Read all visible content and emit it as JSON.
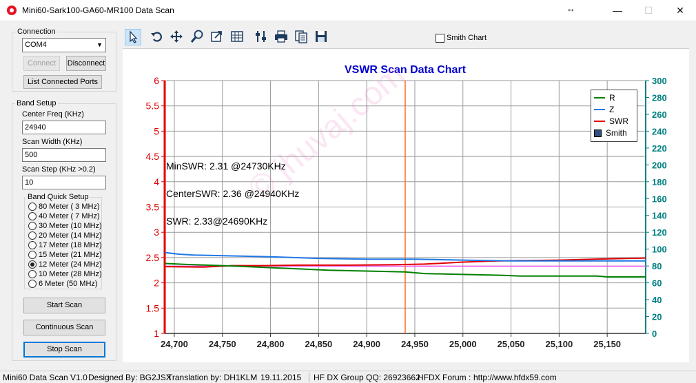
{
  "window": {
    "title": "Mini60-Sark100-GA60-MR100 Data Scan",
    "resize_glyph": "↔",
    "controls": {
      "minimize": "—",
      "maximize": "☐",
      "close": "✕"
    }
  },
  "connection": {
    "label": "Connection",
    "port_value": "COM4",
    "connect_label": "Connect",
    "disconnect_label": "Disconnect",
    "list_ports_label": "List Connected Ports"
  },
  "band_setup": {
    "label": "Band Setup",
    "center_freq_label": "Center Freq  (KHz)",
    "center_freq_value": "24940",
    "scan_width_label": "Scan Width   (KHz)",
    "scan_width_value": "500",
    "scan_step_label": "Scan Step     (KHz >0.2)",
    "scan_step_value": "10",
    "quick_setup_label": "Band Quick Setup",
    "bands": [
      {
        "label": "80 Meter (  3 MHz)",
        "checked": false
      },
      {
        "label": "40 Meter (  7 MHz)",
        "checked": false
      },
      {
        "label": "30 Meter (10 MHz)",
        "checked": false
      },
      {
        "label": "20 Meter (14 MHz)",
        "checked": false
      },
      {
        "label": "17 Meter (18 MHz)",
        "checked": false
      },
      {
        "label": "15 Meter (21 MHz)",
        "checked": false
      },
      {
        "label": "12 Meter (24 MHz)",
        "checked": true
      },
      {
        "label": "10 Meter (28 MHz)",
        "checked": false
      },
      {
        "label": "6 Meter  (50 MHz)",
        "checked": false
      }
    ],
    "start_scan_label": "Start Scan",
    "continuous_scan_label": "Continuous Scan",
    "stop_scan_label": "Stop Scan"
  },
  "toolbar": {
    "icons": [
      "pointer-icon",
      "undo-icon",
      "pan-icon",
      "zoom-icon",
      "export-icon",
      "grid-icon",
      "settings-icon",
      "print-icon",
      "copy-icon",
      "save-icon"
    ],
    "smith_chart_label": "Smith Chart",
    "smith_chart_checked": false
  },
  "chart_data": {
    "type": "line",
    "title": "VSWR Scan Data Chart",
    "xlabel": "",
    "ylabel": "",
    "xlim": [
      24690,
      25190
    ],
    "ylim": [
      1,
      6
    ],
    "y2lim": [
      0,
      300
    ],
    "x_ticks": [
      "24,700",
      "24,750",
      "24,800",
      "24,850",
      "24,900",
      "24,950",
      "25,000",
      "25,050",
      "25,100",
      "25,150"
    ],
    "y_ticks": [
      "1",
      "1.5",
      "2",
      "2.5",
      "3",
      "3.5",
      "4",
      "4.5",
      "5",
      "5.5",
      "6"
    ],
    "y2_ticks": [
      "0",
      "20",
      "40",
      "60",
      "80",
      "100",
      "120",
      "140",
      "160",
      "180",
      "200",
      "220",
      "240",
      "260",
      "280",
      "300"
    ],
    "grid": true,
    "legend_position": "top-right",
    "legend": [
      "R",
      "Z",
      "SWR",
      "Smith"
    ],
    "colors": {
      "R": "#008000",
      "Z": "#1e78e6",
      "SWR": "#e00000",
      "Smith": "#2f4f7f",
      "marker": "#ff6820",
      "reference": "#ee55ee",
      "title": "#0000cc",
      "left_axis": "#e00000",
      "right_axis": "#008080"
    },
    "marker_x": 24940,
    "reference_swr": 2.33,
    "series": [
      {
        "name": "SWR",
        "axis": "left",
        "x": [
          24690,
          24730,
          24760,
          24790,
          24830,
          24880,
          24930,
          24960,
          24980,
          25000,
          25030,
          25060,
          25100,
          25140,
          25190
        ],
        "values": [
          2.32,
          2.31,
          2.34,
          2.34,
          2.35,
          2.35,
          2.36,
          2.37,
          2.39,
          2.41,
          2.43,
          2.44,
          2.45,
          2.47,
          2.49
        ]
      },
      {
        "name": "R",
        "axis": "right",
        "x": [
          24690,
          24710,
          24760,
          24800,
          24820,
          24860,
          24900,
          24940,
          24960,
          25000,
          25040,
          25060,
          25140,
          25150,
          25190
        ],
        "values": [
          83,
          82,
          80,
          78,
          77,
          75,
          74,
          73,
          71,
          70,
          69,
          68,
          68,
          67,
          67
        ]
      },
      {
        "name": "Z",
        "axis": "right",
        "x": [
          24690,
          24705,
          24720,
          24760,
          24800,
          24850,
          24900,
          24950,
          25000,
          25050,
          25100,
          25150,
          25190
        ],
        "values": [
          96,
          94,
          93,
          92,
          91,
          89,
          88,
          88,
          87,
          86,
          86,
          86,
          86
        ]
      }
    ],
    "annotations": [
      {
        "text": "MinSWR: 2.31 @24730KHz",
        "color": "#e00000"
      },
      {
        "text": "CenterSWR: 2.36 @24940KHz",
        "color": "#000080"
      },
      {
        "text": "SWR: 2.33@24690KHz",
        "color": "#000000"
      }
    ]
  },
  "watermark": "© jhuvaj.com",
  "status_bar": [
    "Mini60 Data Scan V1.0",
    "Designed By: BG2JSX",
    "Translation by: DH1KLM",
    "19.11.2015",
    "HF DX Group QQ: 26923662",
    "HFDX Forum :",
    "http://www.hfdx59.com"
  ]
}
